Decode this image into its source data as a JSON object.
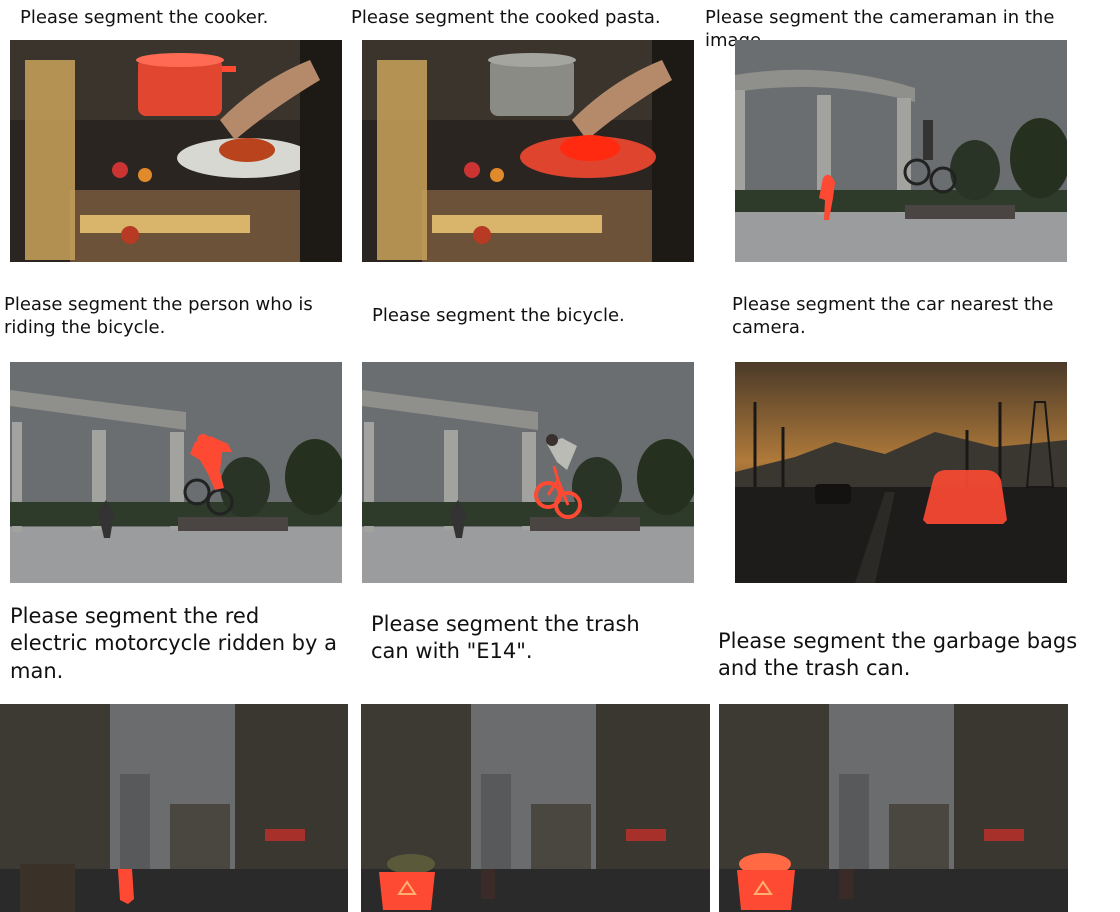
{
  "captions": {
    "cooker": "Please segment the cooker.",
    "pasta": "Please segment the cooked pasta.",
    "cameraman": "Please segment the cameraman in the image.",
    "rider": "Please segment the person who is riding the bicycle.",
    "bicycle": "Please segment the bicycle.",
    "car": "Please segment the car nearest the camera.",
    "motorcycle": "Please segment the red electric motorcycle ridden by a man.",
    "trash_e14": "Please segment the trash can with \"E14\".",
    "garbage": "Please segment the garbage bags and the trash can."
  },
  "colors": {
    "mask": "#ff4a33",
    "plaza_sky": "#6b6e70",
    "sunset_sky": "#b07a3a",
    "street_sky": "#6a6c6d"
  }
}
